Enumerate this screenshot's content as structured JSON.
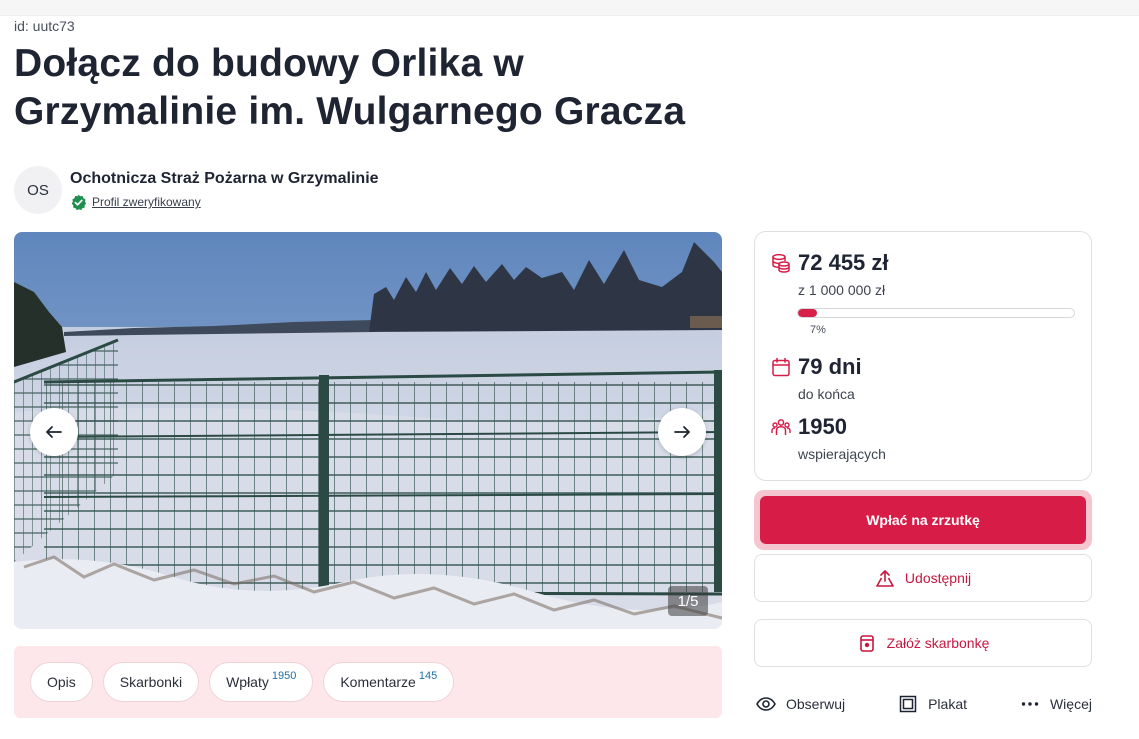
{
  "page_id": "id: uutc73",
  "title": "Dołącz do budowy Orlika w Grzymalinie im. Wulgarnego Gracza",
  "organizer": {
    "avatar_initials": "OS",
    "name": "Ochotnicza Straż Pożarna w Grzymalinie",
    "verified_label": "Profil zweryfikowany",
    "verified_icon": "verified-badge-icon"
  },
  "gallery": {
    "counter": "1/5",
    "prev_icon": "arrow-left-icon",
    "next_icon": "arrow-right-icon"
  },
  "tabs": [
    {
      "label": "Opis",
      "count": ""
    },
    {
      "label": "Skarbonki",
      "count": ""
    },
    {
      "label": "Wpłaty",
      "count": "1950"
    },
    {
      "label": "Komentarze",
      "count": "145"
    }
  ],
  "stats": {
    "raised": "72 455 zł",
    "goal": "z 1 000 000 zł",
    "progress_label": "7%",
    "progress_fraction": 0.07,
    "days": "79 dni",
    "days_label": "do końca",
    "supporters": "1950",
    "supporters_label": "wspierających"
  },
  "buttons": {
    "donate": "Wpłać na zrzutkę",
    "share": "Udostępnij",
    "piggybank": "Załóż skarbonkę"
  },
  "actions": {
    "observe": "Obserwuj",
    "poster": "Plakat",
    "more": "Więcej"
  },
  "colors": {
    "accent": "#d61c47",
    "accent_text": "#c8173f",
    "tabs_background": "#fde7ea",
    "verified_green": "#1e8f4e"
  }
}
